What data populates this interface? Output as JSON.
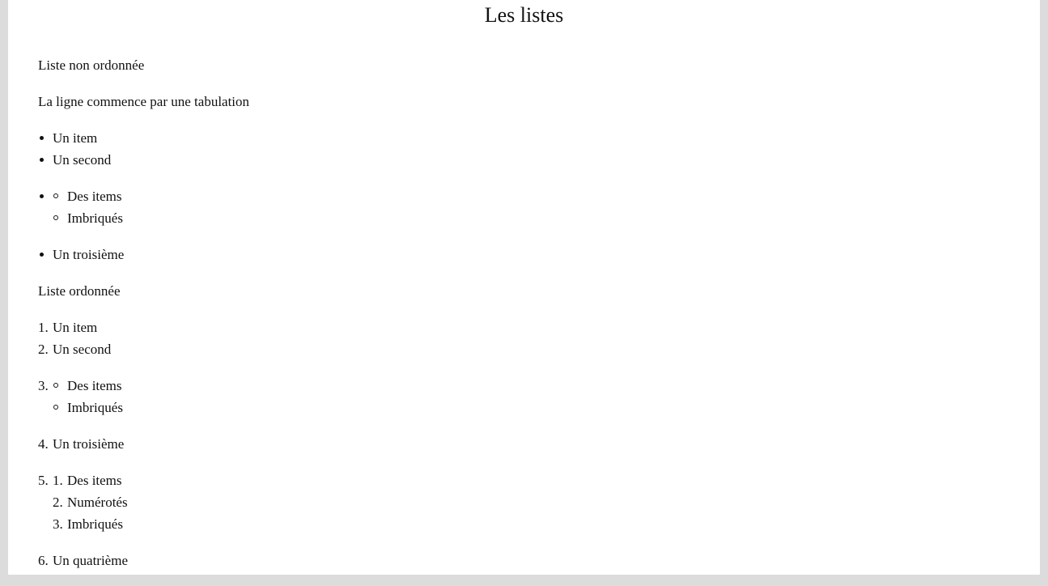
{
  "title": "Les listes",
  "unordered": {
    "heading": "Liste non ordonnée",
    "intro": "La ligne commence par une tabulation",
    "items": [
      "Un item",
      "Un second"
    ],
    "nested": [
      "Des items",
      "Imbriqués"
    ],
    "after": "Un troisième"
  },
  "ordered": {
    "heading": "Liste ordonnée",
    "markers": [
      "1.",
      "2.",
      "3.",
      "4.",
      "5.",
      "6."
    ],
    "items": [
      "Un item",
      "Un second"
    ],
    "nested_bullets": [
      "Des items",
      "Imbriqués"
    ],
    "item4": "Un troisième",
    "nested_numbers": [
      "1.",
      "2.",
      "3."
    ],
    "nested_numbered": [
      "Des items",
      "Numérotés",
      "Imbriqués"
    ],
    "item6": "Un quatrième"
  }
}
